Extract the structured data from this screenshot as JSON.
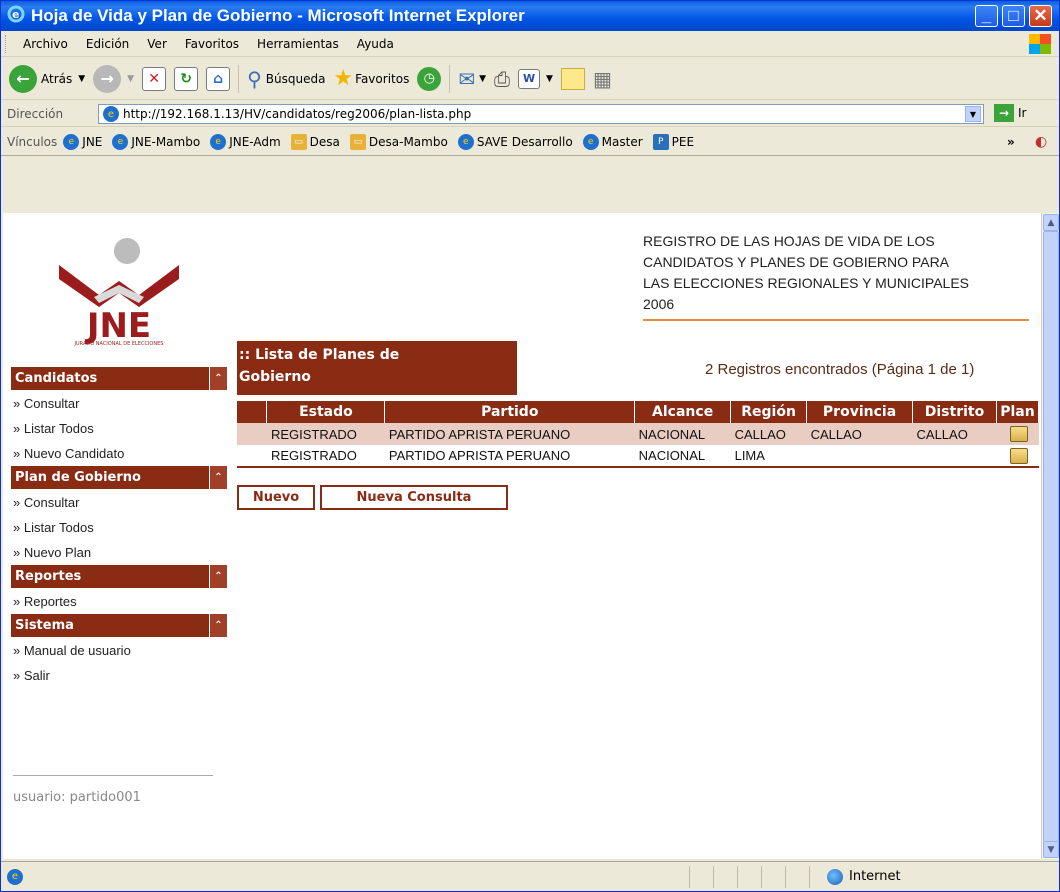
{
  "window": {
    "title": "Hoja de Vida y Plan de Gobierno - Microsoft Internet Explorer"
  },
  "menu": [
    "Archivo",
    "Edición",
    "Ver",
    "Favoritos",
    "Herramientas",
    "Ayuda"
  ],
  "toolbar": {
    "back": "Atrás",
    "search": "Búsqueda",
    "favorites": "Favoritos"
  },
  "address": {
    "label": "Dirección",
    "url": "http://192.168.1.13/HV/candidatos/reg2006/plan-lista.php",
    "go": "Ir"
  },
  "links": {
    "label": "Vínculos",
    "items": [
      "JNE",
      "JNE-Mambo",
      "JNE-Adm",
      "Desa",
      "Desa-Mambo",
      "SAVE Desarrollo",
      "Master",
      "PEE"
    ]
  },
  "logo": {
    "text": "JNE",
    "subtitle": "JURADO NACIONAL DE ELECCIONES"
  },
  "header": {
    "line1": "REGISTRO DE LAS HOJAS DE VIDA DE LOS",
    "line2": "CANDIDATOS Y PLANES DE GOBIERNO PARA",
    "line3": "LAS ELECCIONES REGIONALES Y MUNICIPALES",
    "line4": "2006"
  },
  "sidebar": {
    "sections": [
      {
        "title": "Candidatos",
        "items": [
          "» Consultar",
          "» Listar Todos",
          "» Nuevo Candidato"
        ]
      },
      {
        "title": "Plan de Gobierno",
        "items": [
          "» Consultar",
          "» Listar Todos",
          "» Nuevo Plan"
        ]
      },
      {
        "title": "Reportes",
        "items": [
          "» Reportes"
        ]
      },
      {
        "title": "Sistema",
        "items": [
          "» Manual de usuario",
          "» Salir"
        ]
      }
    ],
    "user": "usuario: partido001"
  },
  "list": {
    "title_line1": ":: Lista de Planes de",
    "title_line2": "Gobierno",
    "count": "2 Registros encontrados (Página 1 de 1)",
    "columns": [
      "Estado",
      "Partido",
      "Alcance",
      "Región",
      "Provincia",
      "Distrito",
      "Plan"
    ],
    "rows": [
      [
        "REGISTRADO",
        "PARTIDO APRISTA PERUANO",
        "NACIONAL",
        "CALLAO",
        "CALLAO",
        "CALLAO"
      ],
      [
        "REGISTRADO",
        "PARTIDO APRISTA PERUANO",
        "NACIONAL",
        "LIMA",
        "",
        ""
      ]
    ]
  },
  "buttons": {
    "new": "Nuevo",
    "new_query": "Nueva Consulta"
  },
  "status": {
    "zone": "Internet"
  },
  "colors": {
    "brand": "#8a2b14",
    "accent": "#e88a3a",
    "row_alt": "#e9ccc2"
  }
}
